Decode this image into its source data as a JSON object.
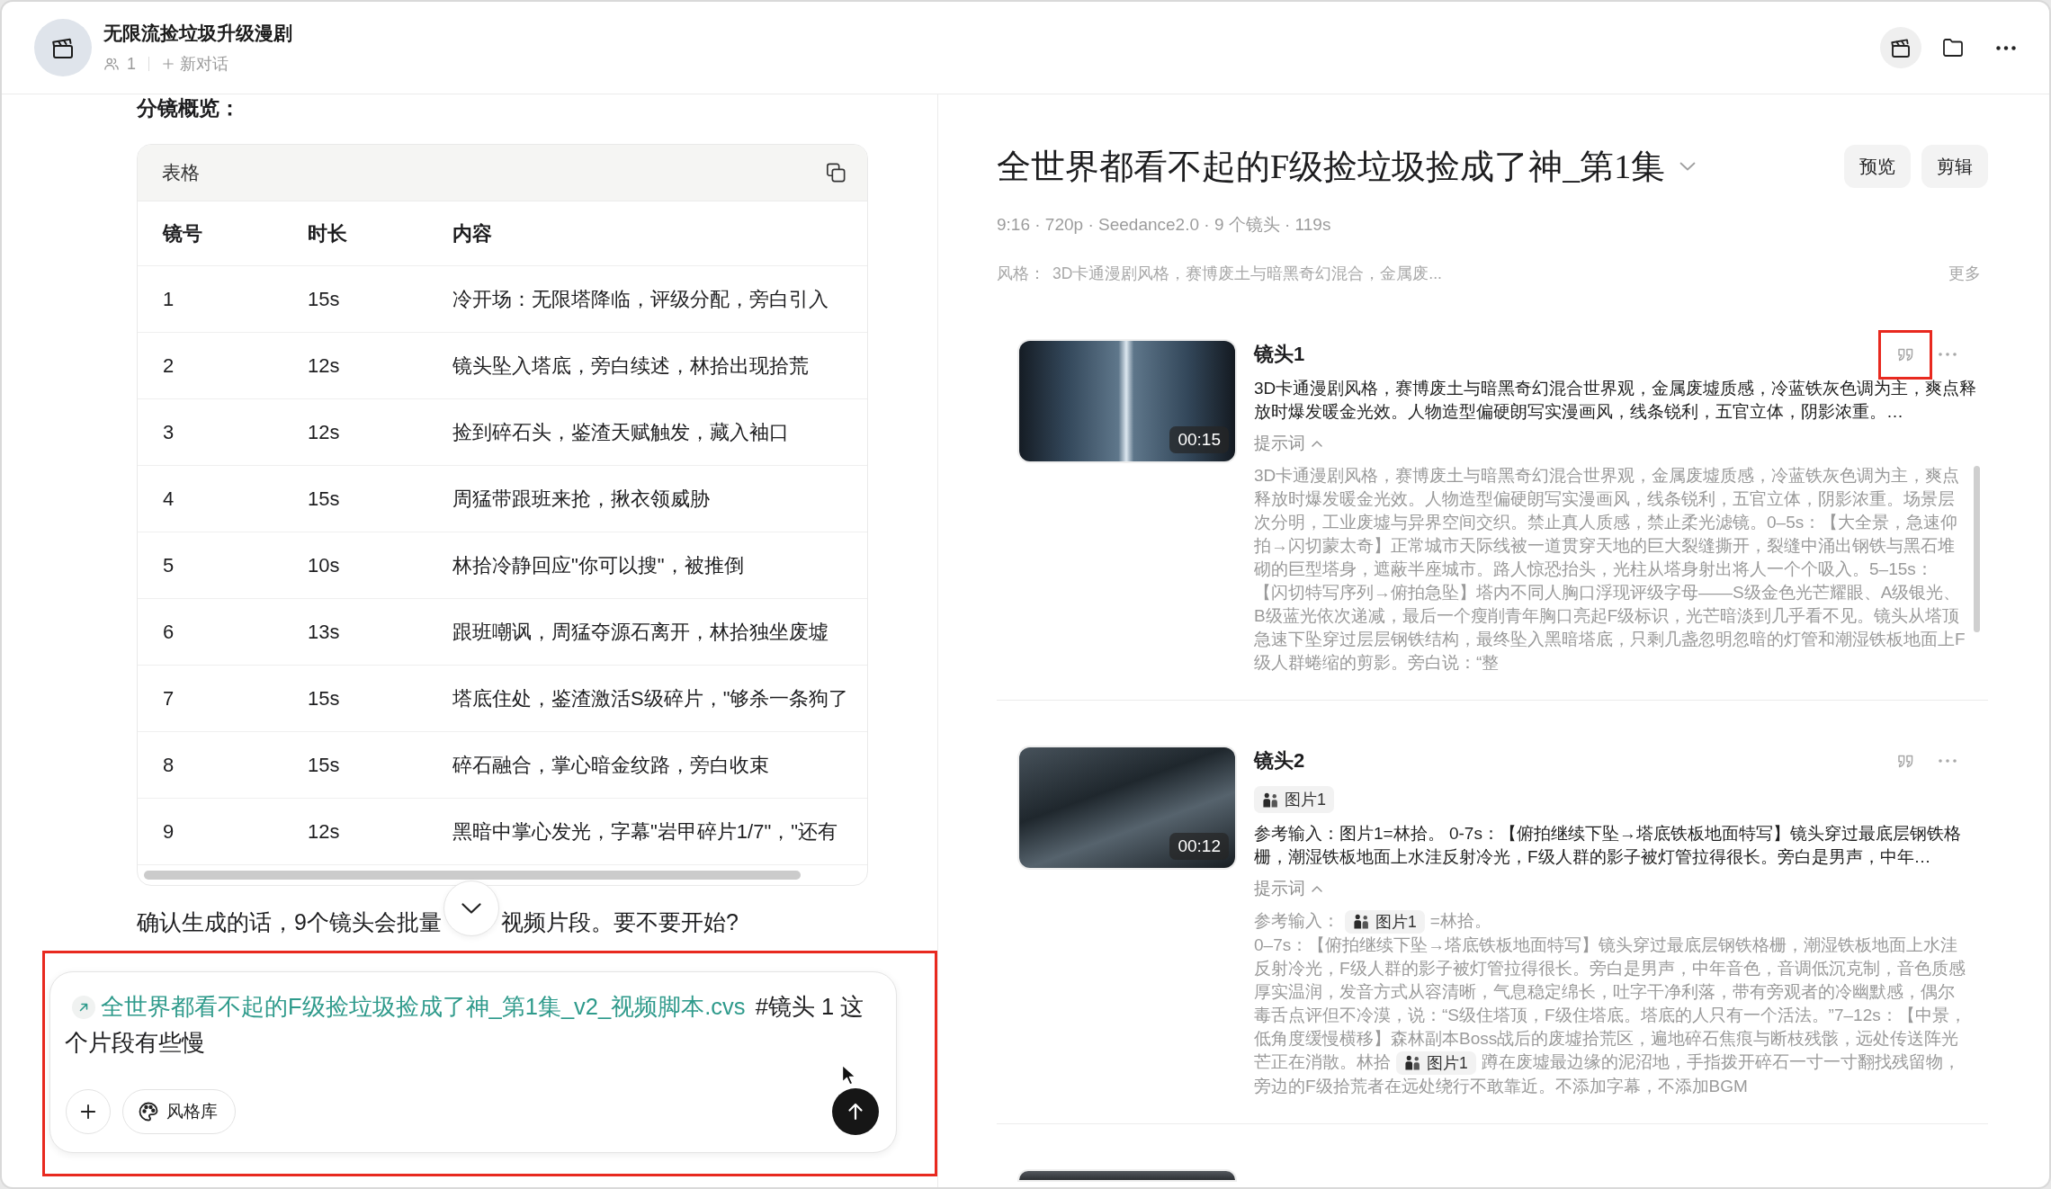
{
  "header": {
    "title": "无限流捡垃圾升级漫剧",
    "member_count": "1",
    "new_chat": "新对话"
  },
  "chat": {
    "heading": "分镜概览：",
    "table": {
      "label": "表格",
      "columns": [
        "镜号",
        "时长",
        "内容"
      ],
      "rows": [
        [
          "1",
          "15s",
          "冷开场：无限塔降临，评级分配，旁白引入"
        ],
        [
          "2",
          "12s",
          "镜头坠入塔底，旁白续述，林拾出现拾荒"
        ],
        [
          "3",
          "12s",
          "捡到碎石头，鉴渣天赋触发，藏入袖口"
        ],
        [
          "4",
          "15s",
          "周猛带跟班来抢，揪衣领威胁"
        ],
        [
          "5",
          "10s",
          "林拾冷静回应\"你可以搜\"，被推倒"
        ],
        [
          "6",
          "13s",
          "跟班嘲讽，周猛夺源石离开，林拾独坐废墟"
        ],
        [
          "7",
          "15s",
          "塔底住处，鉴渣激活S级碎片，\"够杀一条狗了"
        ],
        [
          "8",
          "15s",
          "碎石融合，掌心暗金纹路，旁白收束"
        ],
        [
          "9",
          "12s",
          "黑暗中掌心发光，字幕\"岩甲碎片1/7\"，\"还有"
        ]
      ]
    },
    "message_parts": [
      "确认生成的话，9个镜头会批量",
      "视频片段。要不要开始?"
    ]
  },
  "composer": {
    "highlighted": true,
    "link": "全世界都看不起的F级捡垃圾捡成了神_第1集_v2_视频脚本.cvs",
    "text": "#镜头 1 这个片段有些慢",
    "style_button": "风格库"
  },
  "project": {
    "title": "全世界都看不起的F级捡垃圾捡成了神_第1集",
    "buttons": [
      "预览",
      "剪辑"
    ],
    "meta": "9:16 · 720p · Seedance2.0 · 9 个镜头 · 119s",
    "style_label": "风格：",
    "style_value": "3D卡通漫剧风格，赛博废土与暗黑奇幻混合，金属废...",
    "more": "更多"
  },
  "shots": [
    {
      "kind": "full",
      "title": "镜头1",
      "duration": "00:15",
      "quote_highlighted": true,
      "summary": "3D卡通漫剧风格，赛博废土与暗黑奇幻混合世界观，金属废墟质感，冷蓝铁灰色调为主，爽点释放时爆发暖金光效。人物造型偏硬朗写实漫画风，线条锐利，五官立体，阴影浓重。…",
      "prompt_label": "提示词",
      "prompt_expanded": true,
      "prompt_scrollable": true,
      "prompt": [
        [
          {
            "kind": "text",
            "text": "3D卡通漫剧风格，赛博废土与暗黑奇幻混合世界观，金属废墟质感，冷蓝铁灰色调为主，爽点释放时爆发暖金光效。人物造型偏硬朗写实漫画风，线条锐利，五官立体，阴影浓重。场景层次分明，工业废墟与异界空间交织。禁止真人质感，禁止柔光滤镜。0–5s：【大全景，急速仰拍→闪切蒙太奇】正常城市天际线被一道贯穿天地的巨大裂缝撕开，裂缝中涌出钢铁与黑石堆砌的巨型塔身，遮蔽半座城市。路人惊恐抬头，光柱从塔身射出将人一个个吸入。5–15s：【闪切特写序列→俯拍急坠】塔内不同人胸口浮现评级字母——S级金色光芒耀眼、A级银光、B级蓝光依次递减，最后一个瘦削青年胸口亮起F级标识，光芒暗淡到几乎看不见。镜头从塔顶急速下坠穿过层层钢铁结构，最终坠入黑暗塔底，只剩几盏忽明忽暗的灯管和潮湿铁板地面上F级人群蜷缩的剪影。旁白说：“整"
          }
        ]
      ]
    },
    {
      "kind": "full",
      "title": "镜头2",
      "duration": "00:12",
      "quote_highlighted": false,
      "chips": [
        "图片1"
      ],
      "summary": "参考输入：图片1=林拾。 0-7s：【俯拍继续下坠→塔底铁板地面特写】镜头穿过最底层钢铁格栅，潮湿铁板地面上水洼反射冷光，F级人群的影子被灯管拉得很长。旁白是男声，中年…",
      "prompt_label": "提示词",
      "prompt_expanded": true,
      "prompt_scrollable": false,
      "prompt": [
        [
          {
            "kind": "text",
            "text": "参考输入："
          },
          {
            "kind": "chip",
            "text": "图片1"
          },
          {
            "kind": "text",
            "text": "=林拾。"
          }
        ],
        [
          {
            "kind": "text",
            "text": "0–7s：【俯拍继续下坠→塔底铁板地面特写】镜头穿过最底层钢铁格栅，潮湿铁板地面上水洼反射冷光，F级人群的影子被灯管拉得很长。旁白是男声，中年音色，音调低沉克制，音色质感厚实温润，发音方式从容清晰，气息稳定绵长，吐字干净利落，带有旁观者的冷幽默感，偶尔毒舌点评但不冷漠，说：“S级住塔顶，F级住塔底。塔底的人只有一个活法。”7–12s：【中景，低角度缓慢横移】森林副本Boss战后的废墟拾荒区，遍地碎石焦痕与断枝残骸，远处传送阵光芒正在消散。林拾"
          },
          {
            "kind": "chip",
            "text": "图片1"
          },
          {
            "kind": "text",
            "text": "蹲在废墟最边缘的泥沼地，手指拨开碎石一寸一寸翻找残留物，旁边的F级拾荒者在远处绕行不敢靠近。不添加字幕，不添加BGM"
          }
        ]
      ]
    },
    {
      "kind": "peek"
    }
  ]
}
